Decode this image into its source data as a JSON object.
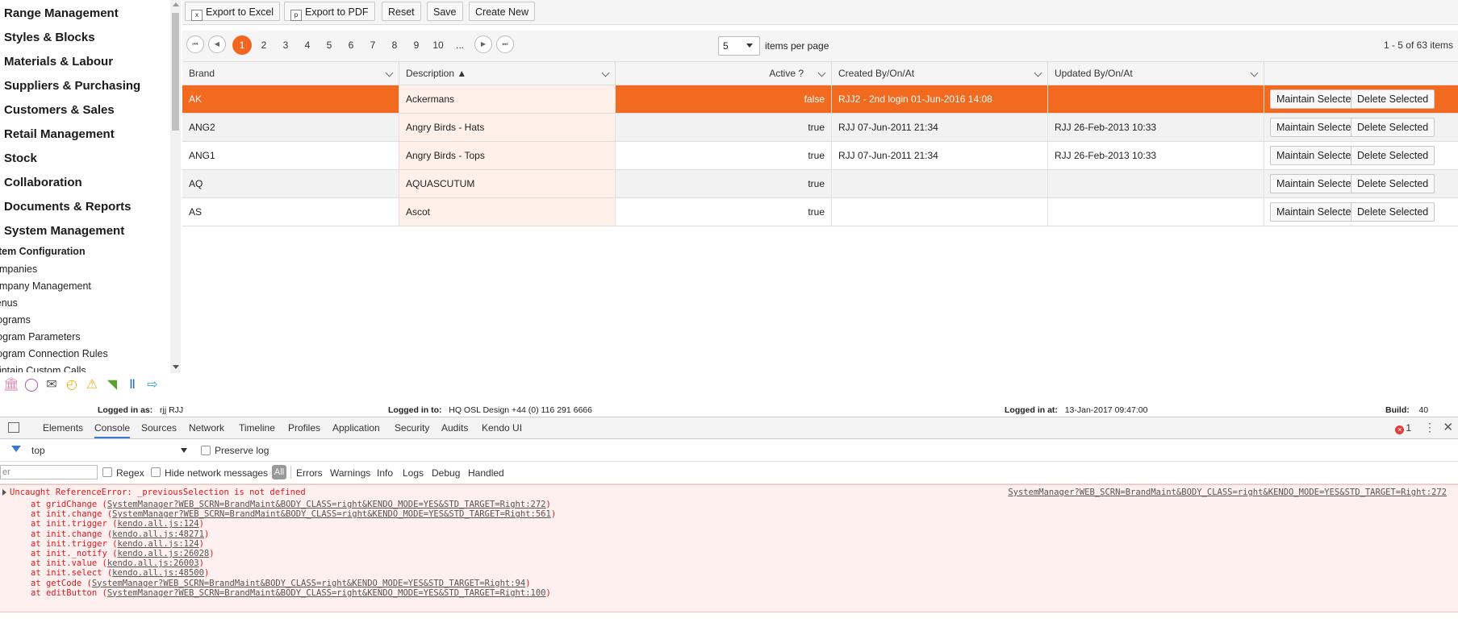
{
  "sidebar": {
    "menu": [
      "Range Management",
      "Styles & Blocks",
      "Materials & Labour",
      "Suppliers & Purchasing",
      "Customers & Sales",
      "Retail Management",
      "Stock",
      "Collaboration",
      "Documents & Reports",
      "System Management"
    ],
    "sub_title": "stem Configuration",
    "sub_items": [
      "ompanies",
      "ompany Management",
      "lenus",
      "rograms",
      "rogram Parameters",
      "rogram Connection Rules",
      "aintain Custom Calls"
    ],
    "quick_icons": [
      "bank-icon",
      "chat-icon",
      "mail-icon",
      "clock-icon",
      "warning-icon",
      "rss-icon",
      "books-icon",
      "logout-icon"
    ]
  },
  "toolbar": {
    "export_excel": "Export to Excel",
    "export_pdf": "Export to PDF",
    "reset": "Reset",
    "save": "Save",
    "create_new": "Create New"
  },
  "pager": {
    "pages": [
      "1",
      "2",
      "3",
      "4",
      "5",
      "6",
      "7",
      "8",
      "9",
      "10",
      "..."
    ],
    "current_page": "1",
    "page_size": "5",
    "page_size_label": "items per page",
    "info": "1 - 5 of 63 items"
  },
  "grid": {
    "columns": [
      "Brand",
      "Description ▲",
      "Active ?",
      "Created By/On/At",
      "Updated By/On/At",
      ""
    ],
    "rows": [
      {
        "brand": "AK",
        "description": "Ackermans",
        "active": "false",
        "created": "RJJ2 - 2nd login 01-Jun-2016 14:08",
        "updated": ""
      },
      {
        "brand": "ANG2",
        "description": "Angry Birds - Hats",
        "active": "true",
        "created": "RJJ 07-Jun-2011 21:34",
        "updated": "RJJ 26-Feb-2013 10:33"
      },
      {
        "brand": "ANG1",
        "description": "Angry Birds - Tops",
        "active": "true",
        "created": "RJJ 07-Jun-2011 21:34",
        "updated": "RJJ 26-Feb-2013 10:33"
      },
      {
        "brand": "AQ",
        "description": "AQUASCUTUM",
        "active": "true",
        "created": "",
        "updated": ""
      },
      {
        "brand": "AS",
        "description": "Ascot",
        "active": "true",
        "created": "",
        "updated": ""
      }
    ],
    "maintain_label": "Maintain Selected",
    "delete_label": "Delete Selected",
    "selected_color": "#f26a1f"
  },
  "status": {
    "logged_in_as_label": "Logged in as:",
    "logged_in_as_value": "rjj  RJJ",
    "logged_in_to_label": "Logged in to:",
    "logged_in_to_value": "HQ OSL Design +44 (0) 116 291 6666",
    "logged_in_at_label": "Logged in at:",
    "logged_in_at_value": "13-Jan-2017  09:47:00",
    "build_label": "Build:",
    "build_value": "40"
  },
  "devtools": {
    "tabs": [
      "Elements",
      "Console",
      "Sources",
      "Network",
      "Timeline",
      "Profiles",
      "Application",
      "Security",
      "Audits",
      "Kendo UI"
    ],
    "active_tab": "Console",
    "error_count": "1",
    "context": "top",
    "preserve_log": "Preserve log",
    "filter_placeholder": "er",
    "regex": "Regex",
    "hide_network": "Hide network messages",
    "all": "All",
    "levels": [
      "Errors",
      "Warnings",
      "Info",
      "Logs",
      "Debug",
      "Handled"
    ],
    "error": {
      "message": "Uncaught ReferenceError: _previousSelection is not defined",
      "source": "SystemManager?WEB_SCRN=BrandMaint&BODY_CLASS=right&KENDO_MODE=YES&STD_TARGET=Right:272",
      "stack": [
        {
          "fn": "at gridChange (",
          "link": "SystemManager?WEB_SCRN=BrandMaint&BODY_CLASS=right&KENDO_MODE=YES&STD_TARGET=Right:272",
          "end": ")"
        },
        {
          "fn": "at init.change (",
          "link": "SystemManager?WEB_SCRN=BrandMaint&BODY_CLASS=right&KENDO_MODE=YES&STD_TARGET=Right:561",
          "end": ")"
        },
        {
          "fn": "at init.trigger (",
          "link": "kendo.all.js:124",
          "end": ")"
        },
        {
          "fn": "at init.change (",
          "link": "kendo.all.js:48271",
          "end": ")"
        },
        {
          "fn": "at init.trigger (",
          "link": "kendo.all.js:124",
          "end": ")"
        },
        {
          "fn": "at init._notify (",
          "link": "kendo.all.js:26028",
          "end": ")"
        },
        {
          "fn": "at init.value (",
          "link": "kendo.all.js:26003",
          "end": ")"
        },
        {
          "fn": "at init.select (",
          "link": "kendo.all.js:48500",
          "end": ")"
        },
        {
          "fn": "at getCode (",
          "link": "SystemManager?WEB_SCRN=BrandMaint&BODY_CLASS=right&KENDO_MODE=YES&STD_TARGET=Right:94",
          "end": ")"
        },
        {
          "fn": "at editButton (",
          "link": "SystemManager?WEB_SCRN=BrandMaint&BODY_CLASS=right&KENDO_MODE=YES&STD_TARGET=Right:100",
          "end": ")"
        }
      ]
    }
  }
}
